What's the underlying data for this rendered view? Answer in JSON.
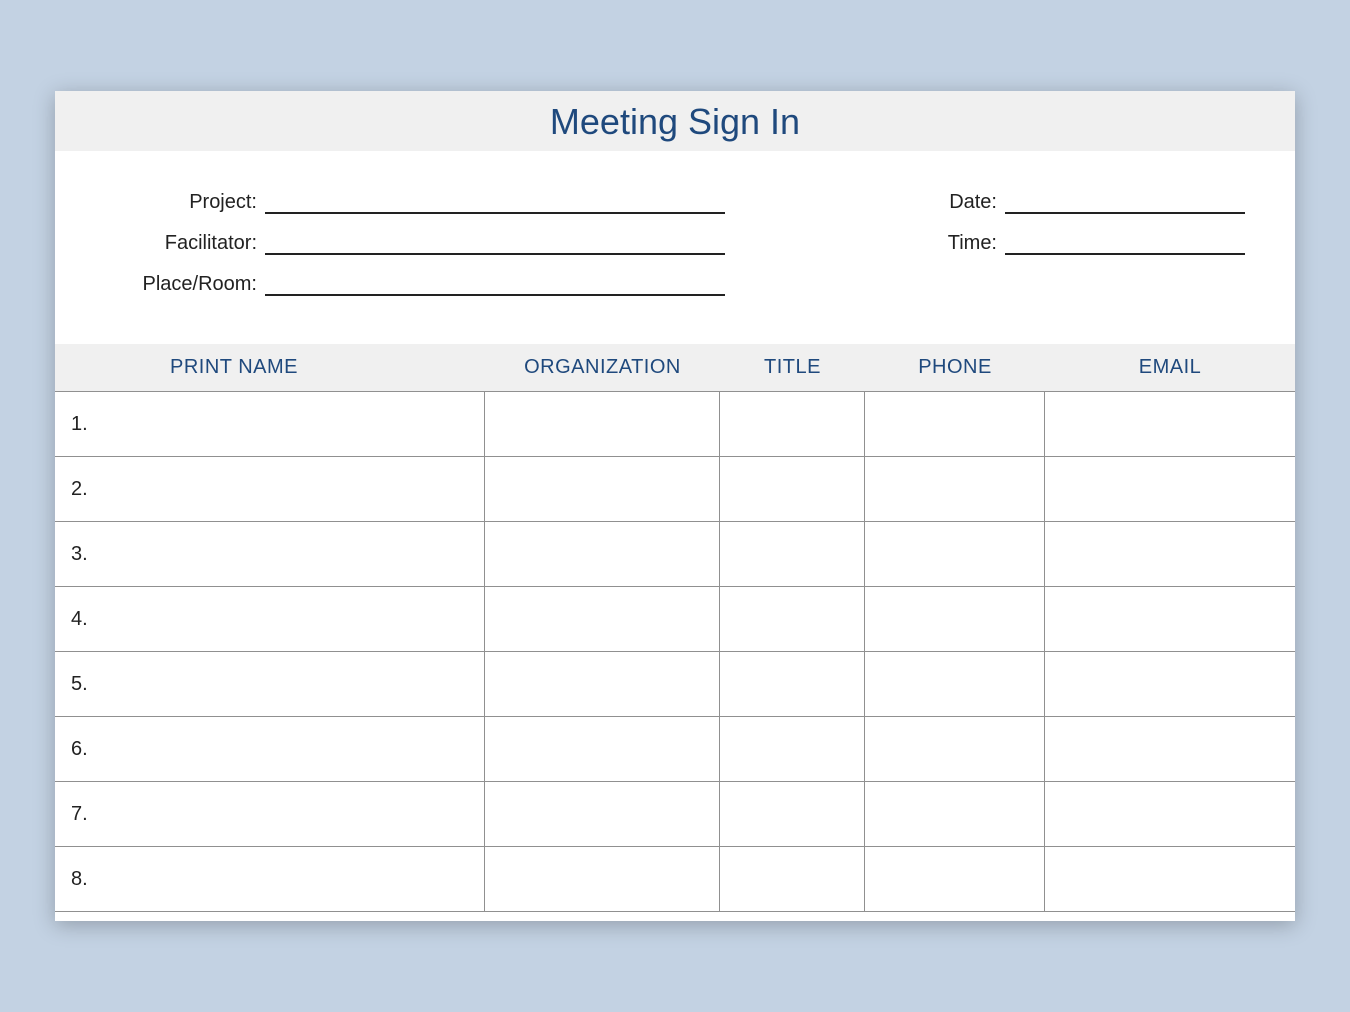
{
  "title": "Meeting Sign In",
  "meta": {
    "left": [
      {
        "label": "Project:"
      },
      {
        "label": "Facilitator:"
      },
      {
        "label": "Place/Room:"
      }
    ],
    "right": [
      {
        "label": "Date:"
      },
      {
        "label": "Time:"
      }
    ]
  },
  "columns": {
    "name": "PRINT NAME",
    "org": "ORGANIZATION",
    "title": "TITLE",
    "phone": "PHONE",
    "email": "EMAIL"
  },
  "rows": [
    {
      "index": "1."
    },
    {
      "index": "2."
    },
    {
      "index": "3."
    },
    {
      "index": "4."
    },
    {
      "index": "5."
    },
    {
      "index": "6."
    },
    {
      "index": "7."
    },
    {
      "index": "8."
    }
  ]
}
